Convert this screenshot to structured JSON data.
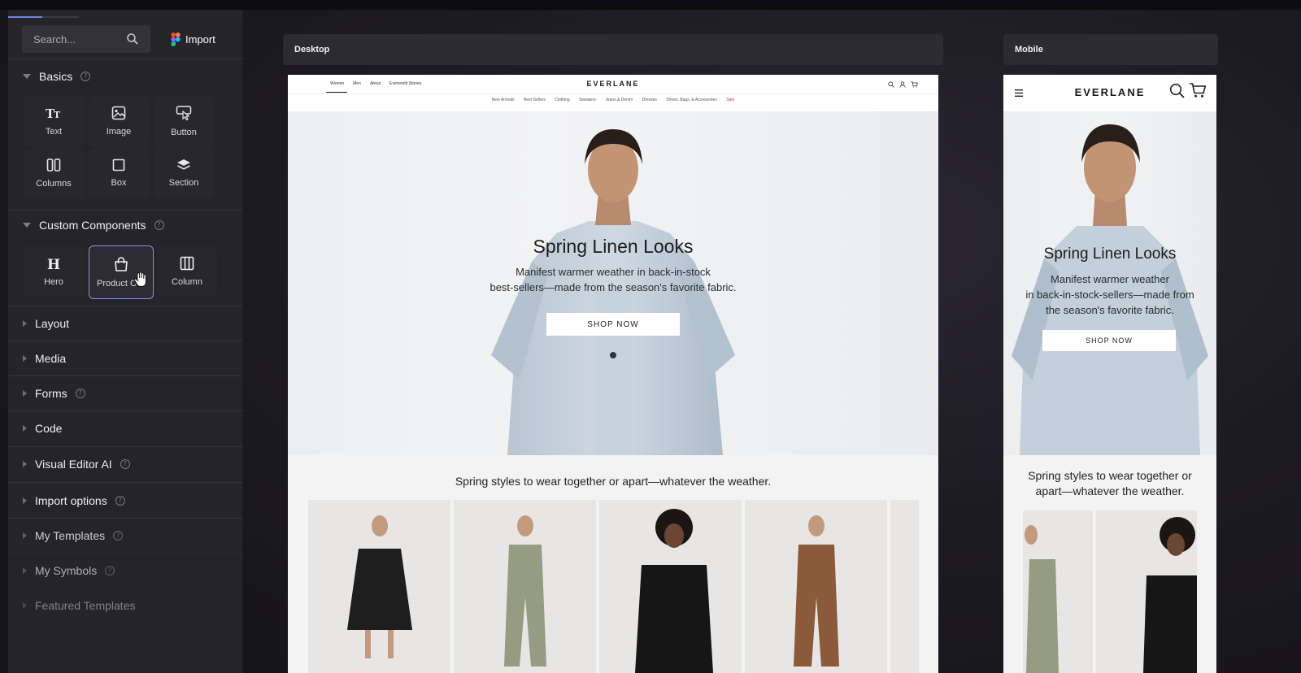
{
  "sidebar": {
    "search": {
      "placeholder": "Search..."
    },
    "import_label": "Import",
    "basics": {
      "title": "Basics",
      "items": [
        {
          "label": "Text",
          "icon": "text-icon"
        },
        {
          "label": "Image",
          "icon": "image-icon"
        },
        {
          "label": "Button",
          "icon": "button-icon"
        },
        {
          "label": "Columns",
          "icon": "columns-icon"
        },
        {
          "label": "Box",
          "icon": "box-icon"
        },
        {
          "label": "Section",
          "icon": "section-icon"
        }
      ]
    },
    "custom": {
      "title": "Custom Components",
      "items": [
        {
          "label": "Hero",
          "icon": "hero-icon"
        },
        {
          "label": "Product Cell",
          "icon": "shopping-bag-icon"
        },
        {
          "label": "Column",
          "icon": "column-icon"
        }
      ]
    },
    "sections": [
      {
        "label": "Layout",
        "help": false
      },
      {
        "label": "Media",
        "help": false
      },
      {
        "label": "Forms",
        "help": true
      },
      {
        "label": "Code",
        "help": false
      },
      {
        "label": "Visual Editor AI",
        "help": true
      },
      {
        "label": "Import options",
        "help": true
      },
      {
        "label": "My Templates",
        "help": true
      },
      {
        "label": "My Symbols",
        "help": true
      },
      {
        "label": "Featured Templates",
        "help": false
      }
    ]
  },
  "frames": {
    "desktop_label": "Desktop",
    "mobile_label": "Mobile"
  },
  "site": {
    "logo": "EVERLANE",
    "nav_links": [
      "Women",
      "Men",
      "About",
      "Everworld Stories"
    ],
    "categories": [
      "New Arrivals",
      "Best-Sellers",
      "Clothing",
      "Sweaters",
      "Jeans & Denim",
      "Dresses",
      "Shoes, Bags, & Accessories",
      "Sale"
    ],
    "hero": {
      "title": "Spring Linen Looks",
      "subtitle_line1": "Manifest warmer weather in back-in-stock",
      "subtitle_line2": "best-sellers—made from the season's favorite fabric.",
      "cta": "SHOP NOW"
    },
    "mobile_hero": {
      "title": "Spring Linen Looks",
      "line1": "Manifest warmer weather",
      "line2": "in back-in-stock-sellers—made from",
      "line3": "the season's favorite fabric.",
      "cta": "SHOP NOW"
    },
    "tagline": "Spring styles to wear together or apart—whatever the weather.",
    "mobile_tagline_line1": "Spring styles to wear together or",
    "mobile_tagline_line2": "apart—whatever the weather."
  },
  "colors": {
    "accent": "#7f97e8",
    "sidebar_bg": "#252428",
    "canvas_bg": "#1d1b22"
  }
}
